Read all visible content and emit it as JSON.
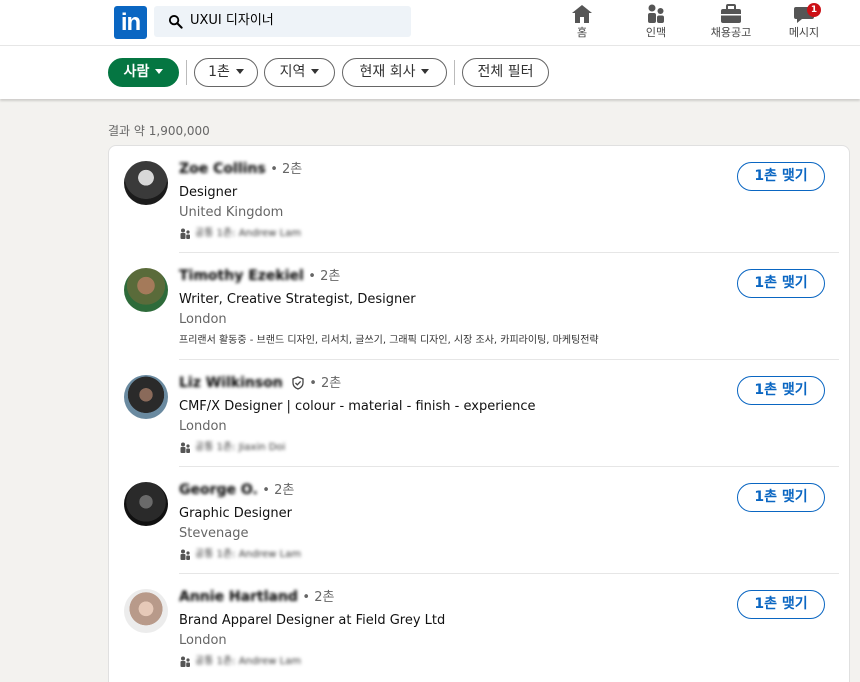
{
  "nav": {
    "logo": "in",
    "search_value": "UXUI 디자이너",
    "items": [
      {
        "label": "홈",
        "icon": "home-icon"
      },
      {
        "label": "인맥",
        "icon": "network-icon"
      },
      {
        "label": "채용공고",
        "icon": "jobs-icon"
      },
      {
        "label": "메시지",
        "icon": "messaging-icon",
        "badge": "1"
      }
    ]
  },
  "filters": {
    "people": "사람",
    "connections": "1촌",
    "location": "지역",
    "current_company": "현재 회사",
    "all_filters": "전체 필터"
  },
  "results_count": "결과 약 1,900,000",
  "results": [
    {
      "name": "Zoe Collins",
      "degree": "• 2촌",
      "headline": "Designer",
      "location": "United Kingdom",
      "extra": "공통 1촌: Andrew Lam",
      "connect": "1촌 맺기"
    },
    {
      "name": "Timothy Ezekiel",
      "degree": "• 2촌",
      "headline": "Writer, Creative Strategist, Designer",
      "location": "London",
      "extra": "프리랜서 활동중 - 브랜드 디자인, 리서치, 글쓰기, 그래픽 디자인, 시장 조사, 카피라이팅, 마케팅전략",
      "connect": "1촌 맺기"
    },
    {
      "name": "Liz Wilkinson",
      "degree": "• 2촌",
      "headline": "CMF/X Designer | colour - material - finish - experience",
      "location": "London",
      "extra": "공통 1촌: Jiaxin Doi",
      "connect": "1촌 맺기"
    },
    {
      "name": "George O.",
      "degree": "• 2촌",
      "headline": "Graphic Designer",
      "location": "Stevenage",
      "extra": "공통 1촌: Andrew Lam",
      "connect": "1촌 맺기"
    },
    {
      "name": "Annie Hartland",
      "degree": "• 2촌",
      "headline": "Brand Apparel Designer at Field Grey Ltd",
      "location": "London",
      "extra": "공통 1촌: Andrew Lam",
      "connect": "1촌 맺기"
    }
  ],
  "colors": {
    "brand": "#0a66c2",
    "active_filter": "#057642",
    "badge": "#cc1016"
  }
}
